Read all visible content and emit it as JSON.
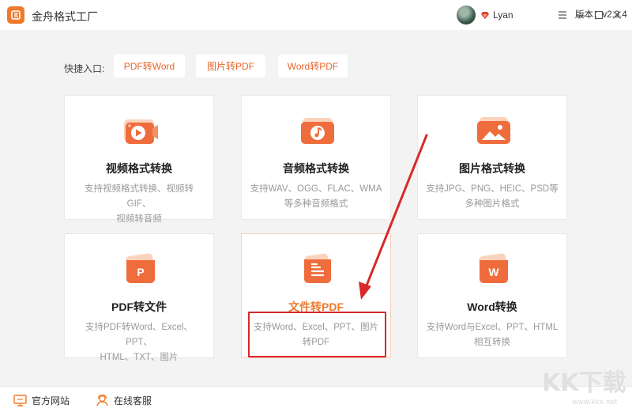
{
  "app": {
    "title": "金舟格式工厂"
  },
  "user": {
    "name": "Lyan"
  },
  "quick": {
    "label": "快捷入口:",
    "items": [
      "PDF转Word",
      "图片转PDF",
      "Word转PDF"
    ]
  },
  "cards": [
    {
      "title": "视频格式转换",
      "desc1": "支持视频格式转换、视频转GIF、",
      "desc2": "视频转音频",
      "icon": "video-icon"
    },
    {
      "title": "音频格式转换",
      "desc1": "支持WAV、OGG、FLAC、WMA",
      "desc2": "等多种音频格式",
      "icon": "music-icon"
    },
    {
      "title": "图片格式转换",
      "desc1": "支持JPG、PNG、HEIC、PSD等",
      "desc2": "多种图片格式",
      "icon": "image-icon"
    },
    {
      "title": "PDF转文件",
      "desc1": "支持PDF转Word、Excel、PPT、",
      "desc2": "HTML、TXT、图片",
      "icon": "pdf-p-icon"
    },
    {
      "title": "文件转PDF",
      "desc1": "支持Word、Excel、PPT、图片",
      "desc2": "转PDF",
      "icon": "document-icon"
    },
    {
      "title": "Word转换",
      "desc1": "支持Word与Excel、PPT、HTML",
      "desc2": "相互转换",
      "icon": "word-w-icon"
    }
  ],
  "footer": {
    "website": "官方网站",
    "service": "在线客服",
    "version": "版本：v2.3.4"
  },
  "watermark": {
    "text": "KK下载",
    "url": "www.kkx.net"
  },
  "colors": {
    "accent": "#ee7a2c",
    "highlight": "#d7282a",
    "background": "#f3f3f3"
  }
}
